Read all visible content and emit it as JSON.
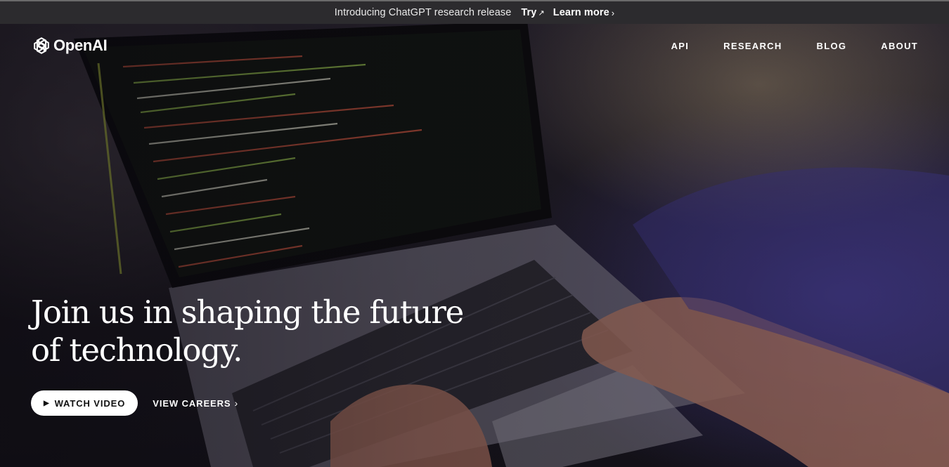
{
  "announcement": {
    "message": "Introducing ChatGPT research release",
    "try_label": "Try",
    "learn_more_label": "Learn more",
    "try_icon": "arrow-up-right-icon",
    "learn_more_icon": "chevron-right-icon"
  },
  "brand": {
    "name": "OpenAI",
    "logo_icon": "openai-logo-icon"
  },
  "nav": {
    "items": [
      {
        "label": "API"
      },
      {
        "label": "RESEARCH"
      },
      {
        "label": "BLOG"
      },
      {
        "label": "ABOUT"
      }
    ]
  },
  "hero": {
    "headline": "Join us in shaping the future of technology.",
    "watch_video_label": "WATCH VIDEO",
    "watch_video_icon": "play-icon",
    "careers_label": "VIEW CAREERS",
    "careers_icon": "chevron-right-icon",
    "background_image": "person typing code on laptop"
  },
  "colors": {
    "announcement_bg": "#2c2b2e",
    "text": "#ffffff",
    "button_bg": "#ffffff",
    "button_text": "#111111",
    "accent_purple": "#46398c"
  }
}
